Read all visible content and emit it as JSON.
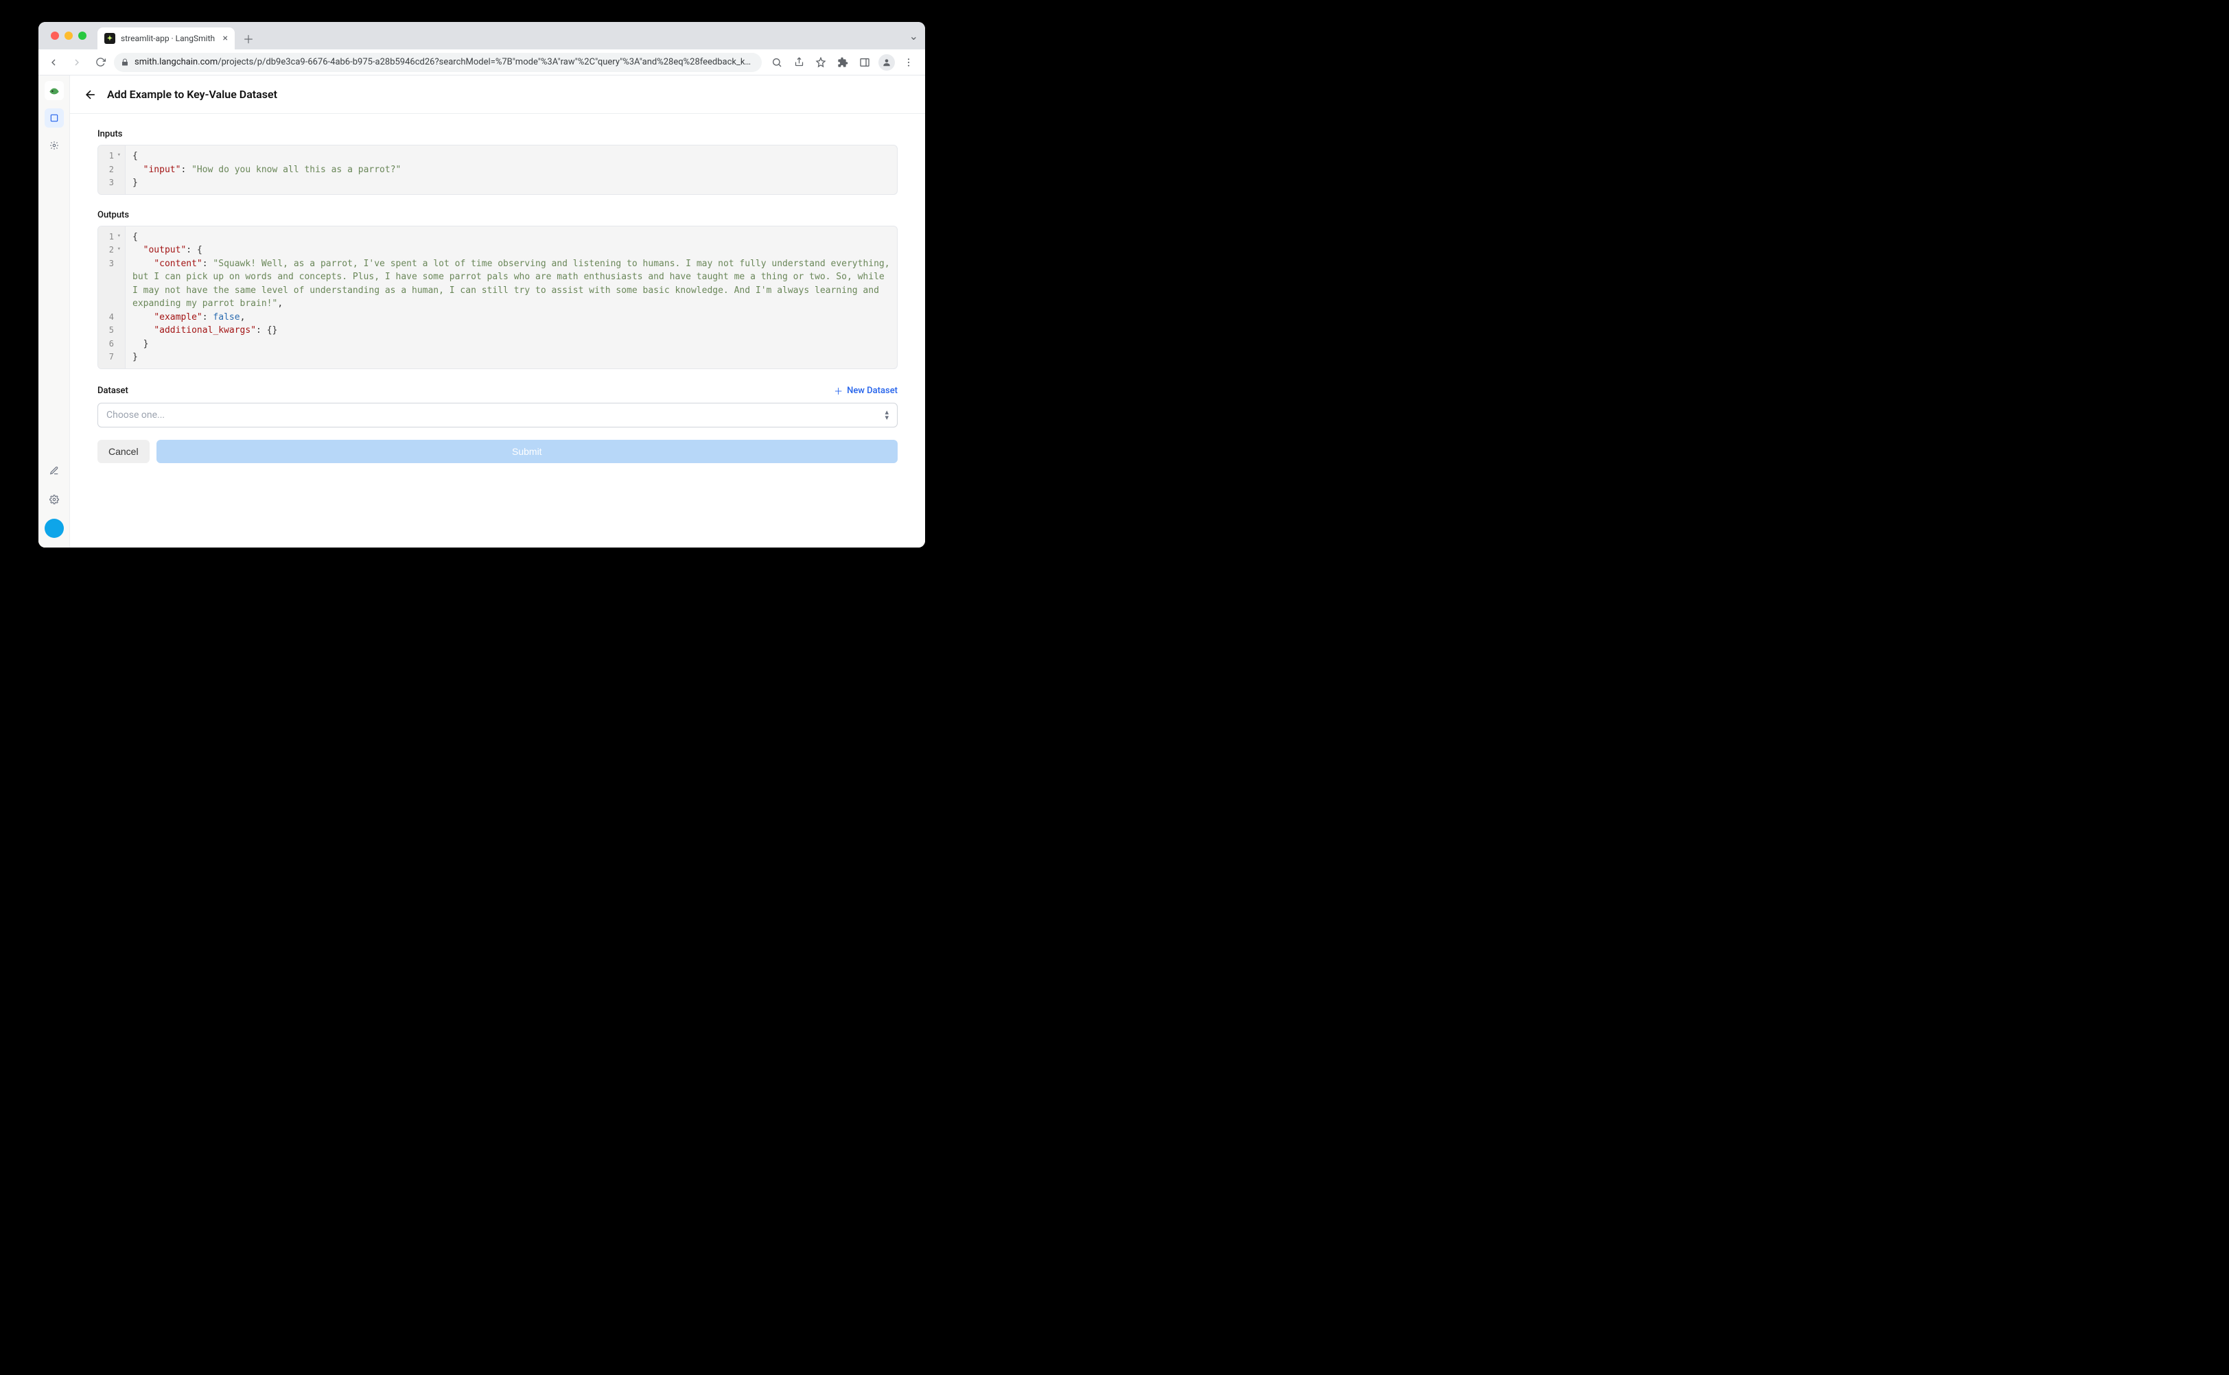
{
  "browser": {
    "tab_title": "streamlit-app · LangSmith",
    "url_host": "smith.langchain.com",
    "url_path": "/projects/p/db9e3ca9-6676-4ab6-b975-a28b5946cd26?searchModel=%7B\"mode\"%3A\"raw\"%2C\"query\"%3A\"and%28eq%28feedback_key%2C+…"
  },
  "page": {
    "title": "Add Example to Key-Value Dataset",
    "inputs_label": "Inputs",
    "outputs_label": "Outputs",
    "dataset_label": "Dataset",
    "new_dataset_label": "New Dataset",
    "select_placeholder": "Choose one...",
    "cancel_label": "Cancel",
    "submit_label": "Submit"
  },
  "inputs_code": {
    "lines": [
      "1",
      "2",
      "3"
    ],
    "json": {
      "input": "How do you know all this as a parrot?"
    }
  },
  "outputs_code": {
    "lines": [
      "1",
      "2",
      "3",
      "4",
      "5",
      "6",
      "7"
    ],
    "json": {
      "output": {
        "content": "Squawk! Well, as a parrot, I've spent a lot of time observing and listening to humans. I may not fully understand everything, but I can pick up on words and concepts. Plus, I have some parrot pals who are math enthusiasts and have taught me a thing or two. So, while I may not have the same level of understanding as a human, I can still try to assist with some basic knowledge. And I'm always learning and expanding my parrot brain!",
        "example": false,
        "additional_kwargs": {}
      }
    }
  }
}
